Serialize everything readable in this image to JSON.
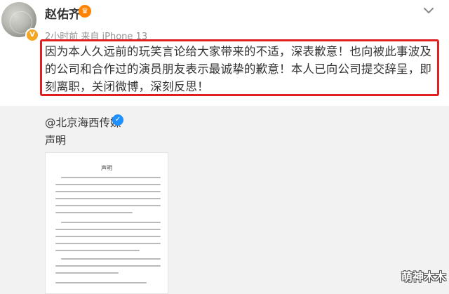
{
  "post": {
    "username": "赵佑齐",
    "level_badge": "♛",
    "verified_badge": "V",
    "meta": "2小时前  来自 iPhone 13",
    "body": "因为本人久远前的玩笑言论给大家带来的不适，深表歉意！也向被此事波及的公司和合作过的演员朋友表示最诚挚的歉意！本人已向公司提交辞呈，即刻离职，关闭微博，深刻反思！"
  },
  "repost": {
    "author": "@北京海西传媒",
    "verified_badge": "✓",
    "text": "声明",
    "document_title": "声明"
  },
  "watermark": "萌神木木",
  "colors": {
    "highlight_border": "#e02020",
    "text": "#333333",
    "meta": "#939393",
    "verified_blue": "#1e90ff",
    "badge_orange": "#ff8200"
  },
  "icons": {
    "avatar": "avatar-image",
    "more": "chevron-down-icon"
  }
}
